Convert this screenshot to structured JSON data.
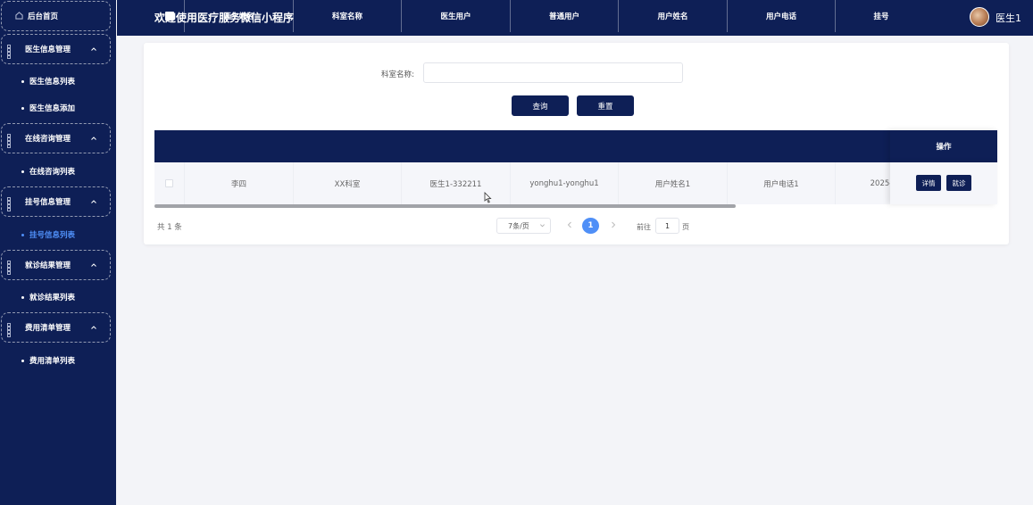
{
  "header": {
    "title": "欢迎使用医疗服务微信小程序",
    "username": "医生1"
  },
  "sidebar": {
    "home": "后台首页",
    "groups": [
      {
        "label": "医生信息管理",
        "items": [
          "医生信息列表",
          "医生信息添加"
        ]
      },
      {
        "label": "在线咨询管理",
        "items": [
          "在线咨询列表"
        ]
      },
      {
        "label": "挂号信息管理",
        "items": [
          "挂号信息列表"
        ]
      },
      {
        "label": "就诊结果管理",
        "items": [
          "就诊结果列表"
        ]
      },
      {
        "label": "费用清单管理",
        "items": [
          "费用清单列表"
        ]
      }
    ],
    "active_item": "挂号信息列表"
  },
  "search": {
    "label": "科室名称:",
    "value": "",
    "query_button": "查询",
    "reset_button": "重置"
  },
  "table": {
    "columns": [
      "医生姓名",
      "科室名称",
      "医生用户",
      "普通用户",
      "用户姓名",
      "用户电话",
      "挂号",
      "操作"
    ],
    "rows": [
      {
        "doctor_name": "李四",
        "department": "XX科室",
        "doctor_user": "医生1-332211",
        "normal_user": "yonghu1-yonghu1",
        "user_name": "用户姓名1",
        "user_phone": "用户电话1",
        "register": "2025-"
      }
    ],
    "actions": [
      "详情",
      "就诊"
    ]
  },
  "pagination": {
    "total": "共 1 条",
    "page_size": "7条/页",
    "current_page": "1",
    "goto_label": "前往",
    "goto_value": "1",
    "page_unit": "页"
  },
  "colors": {
    "primary": "#0e1f56",
    "accent": "#4f8ff7",
    "background": "#f3f4f8"
  },
  "icons": [
    "home-icon",
    "grid-icon",
    "chevron-up-icon",
    "chevron-left-icon",
    "chevron-right-icon",
    "chevron-down-icon",
    "avatar"
  ]
}
